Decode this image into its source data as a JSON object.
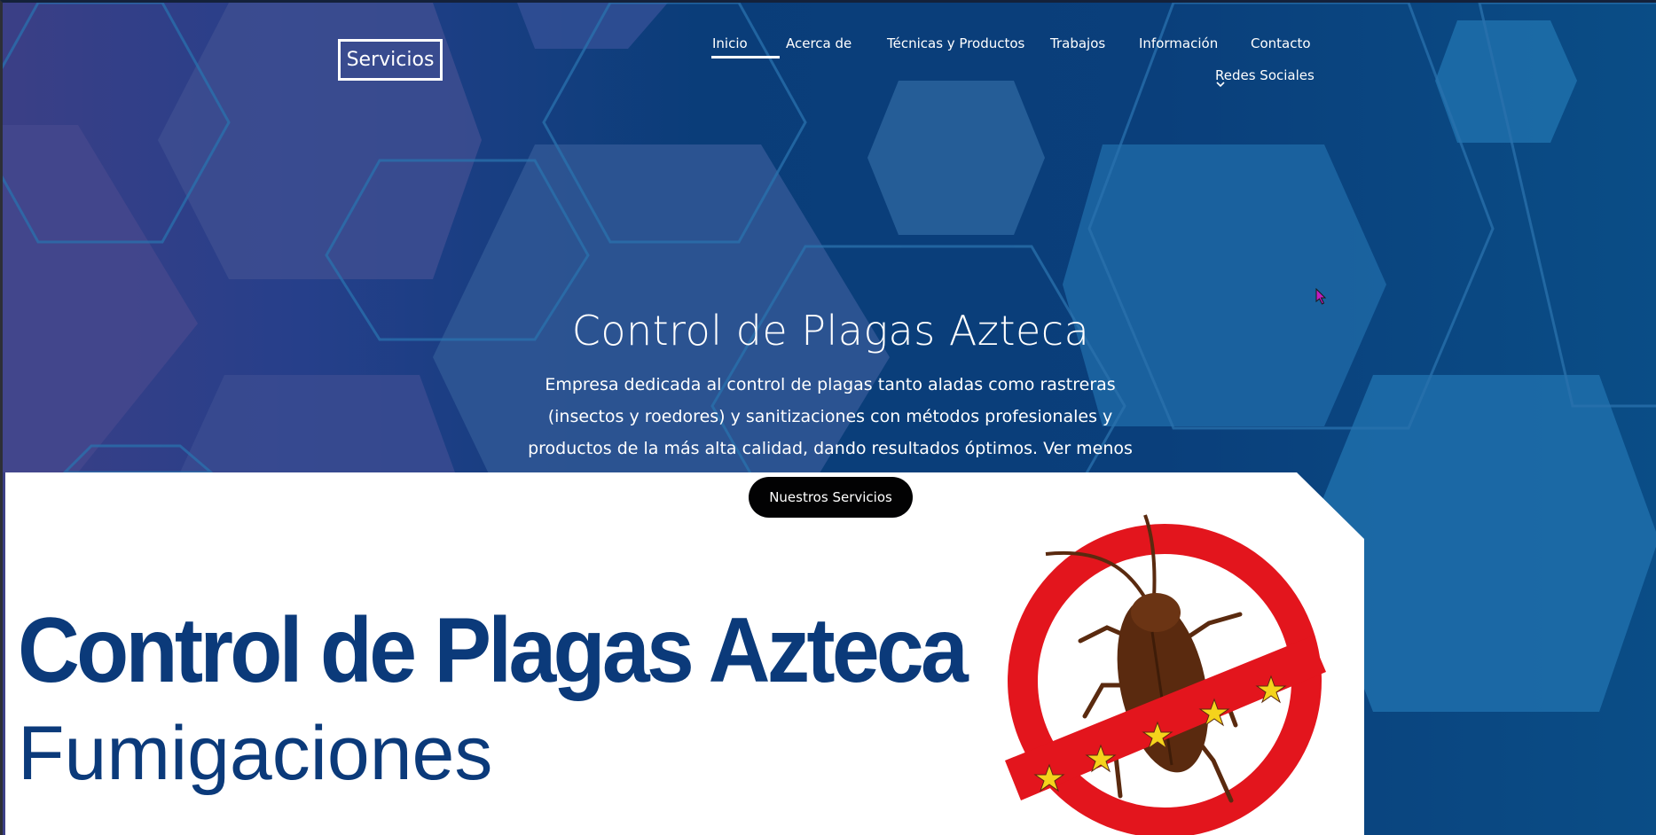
{
  "header": {
    "logo_label": "Servicios",
    "nav": {
      "inicio": "Inicio",
      "acerca": "Acerca de",
      "tecnicas": "Técnicas y Productos",
      "trabajos": "Trabajos",
      "informacion": "Información",
      "contacto": "Contacto",
      "redes": "Redes Sociales"
    },
    "active_item": "Inicio"
  },
  "hero": {
    "title": "Control de Plagas Azteca",
    "description": "Empresa dedicada al control de plagas tanto aladas como rastreras (insectos y roedores) y sanitizaciones con métodos profesionales y productos de la más alta calidad, dando resultados óptimos. Ver menos",
    "cta_label": "Nuestros Servicios"
  },
  "banner": {
    "title": "Control de Plagas Azteca",
    "subtitle": "Fumigaciones",
    "logo_icon": "no-cockroach-icon"
  },
  "colors": {
    "brand_blue": "#0b3a7a",
    "prohibition_red": "#e3151d",
    "cta_black": "#020203",
    "star_yellow": "#f5d31c"
  }
}
